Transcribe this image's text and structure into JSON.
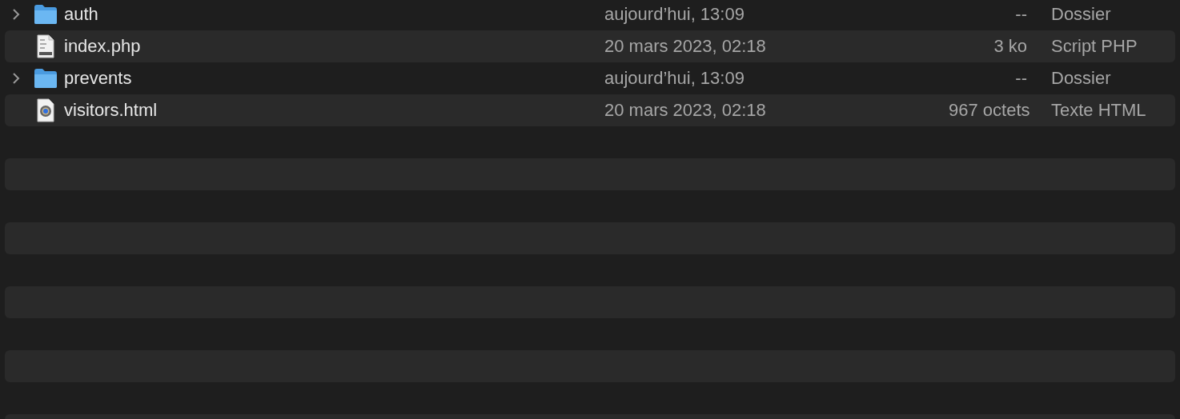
{
  "files": [
    {
      "name": "auth",
      "kind": "folder",
      "expanded": false,
      "modified": "aujourd’hui, 13:09",
      "size": "--",
      "type": "Dossier"
    },
    {
      "name": "index.php",
      "kind": "php",
      "modified": "20 mars 2023, 02:18",
      "size": "3 ko",
      "type": "Script PHP"
    },
    {
      "name": "prevents",
      "kind": "folder",
      "expanded": false,
      "modified": "aujourd’hui, 13:09",
      "size": "--",
      "type": "Dossier"
    },
    {
      "name": "visitors.html",
      "kind": "html",
      "modified": "20 mars 2023, 02:18",
      "size": "967 octets",
      "type": "Texte HTML"
    }
  ]
}
